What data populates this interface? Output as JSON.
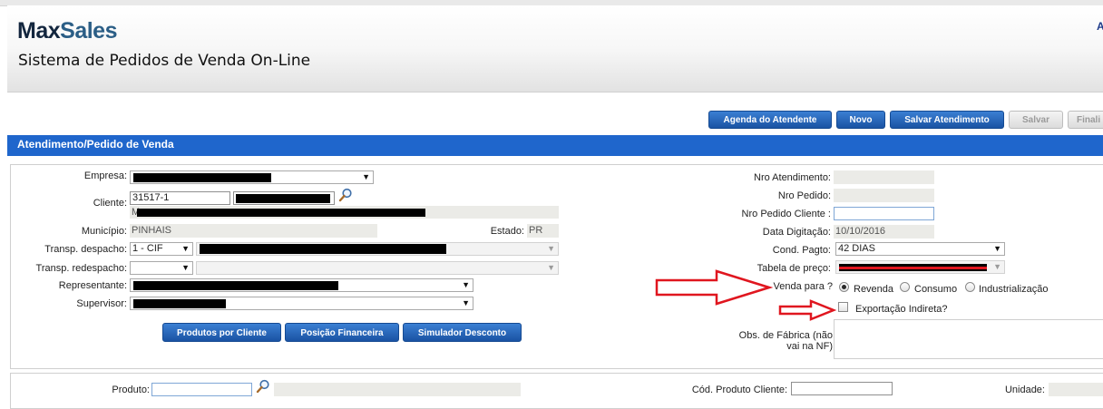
{
  "app": {
    "logo_max": "Max",
    "logo_sales": "Sales",
    "subtitle": "Sistema de Pedidos de Venda On-Line",
    "corner_glyph": "A"
  },
  "toolbar": {
    "agenda": "Agenda do Atendente",
    "novo": "Novo",
    "salvar_atendimento": "Salvar Atendimento",
    "salvar": "Salvar",
    "finalizar": "Finali"
  },
  "section": {
    "title": "Atendimento/Pedido de Venda"
  },
  "form": {
    "empresa_label": "Empresa:",
    "cliente_label": "Cliente:",
    "cliente_code": "31517-1",
    "cliente_name_prefix": "M",
    "municipio_label": "Município:",
    "municipio_value": "PINHAIS",
    "estado_label": "Estado:",
    "estado_value": "PR",
    "transp_despacho_label": "Transp. despacho:",
    "transp_despacho_value": "1 - CIF",
    "transp_redespacho_label": "Transp. redespacho:",
    "representante_label": "Representante:",
    "supervisor_label": "Supervisor:",
    "btn_produtos": "Produtos por Cliente",
    "btn_posicao": "Posição Financeira",
    "btn_simulador": "Simulador Desconto"
  },
  "right": {
    "nro_atendimento_label": "Nro Atendimento:",
    "nro_pedido_label": "Nro Pedido:",
    "nro_pedido_cliente_label": "Nro Pedido Cliente :",
    "data_digitacao_label": "Data Digitação:",
    "data_digitacao_value": "10/10/2016",
    "cond_pagto_label": "Cond. Pagto:",
    "cond_pagto_value": "42 DIAS",
    "tabela_preco_label": "Tabela de preço:",
    "venda_para_label": "Venda para ?",
    "opt_revenda": "Revenda",
    "opt_consumo": "Consumo",
    "opt_industrializacao": "Industrialização",
    "exportacao_label": "Exportação Indireta?",
    "obs_label_1": "Obs. de Fábrica (não",
    "obs_label_2": "vai na NF)"
  },
  "produto": {
    "produto_label": "Produto:",
    "cod_produto_cliente_label": "Cód. Produto Cliente:",
    "unidade_label": "Unidade:"
  },
  "colors": {
    "section_blue": "#1f66cc",
    "annotation_red": "#e0161f",
    "redaction": "#000000"
  },
  "icons": {
    "search": "magnifier-icon",
    "dropdown": "chevron-down-icon",
    "annotation": "red-arrow-icon"
  }
}
